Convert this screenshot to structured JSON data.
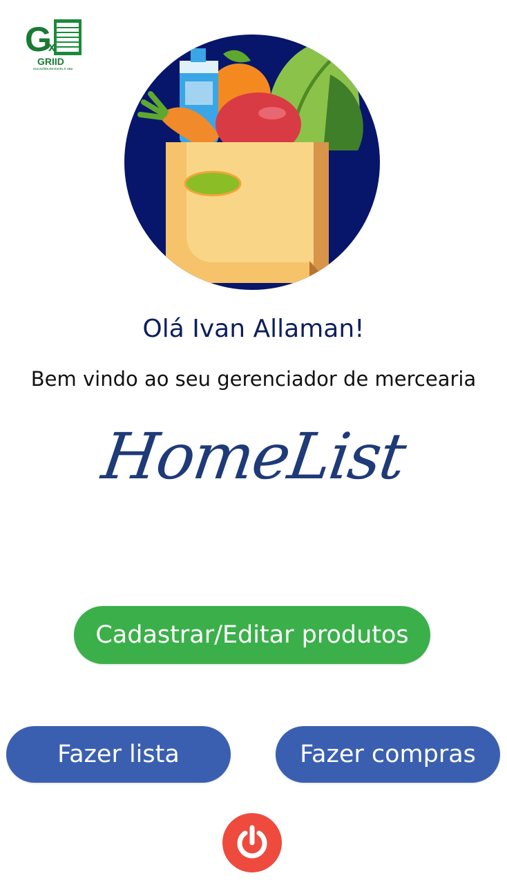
{
  "logo": {
    "letters": "Gx",
    "brand": "GRIID",
    "tagline": "SOLUÇÕES EM EXCEL E VBA"
  },
  "hero": {
    "image": "grocery-bag-illustration"
  },
  "greeting": "Olá Ivan Allaman!",
  "subtitle": "Bem vindo ao seu gerenciador de mercearia",
  "brand_title": "HomeList",
  "buttons": {
    "register_edit": "Cadastrar/Editar produtos",
    "make_list": "Fazer lista",
    "go_shopping": "Fazer compras",
    "power_icon": "power-icon"
  },
  "colors": {
    "green": "#3bb04a",
    "blue": "#3b5fb0",
    "red": "#ee4a3e",
    "navy": "#0d1f5c"
  }
}
